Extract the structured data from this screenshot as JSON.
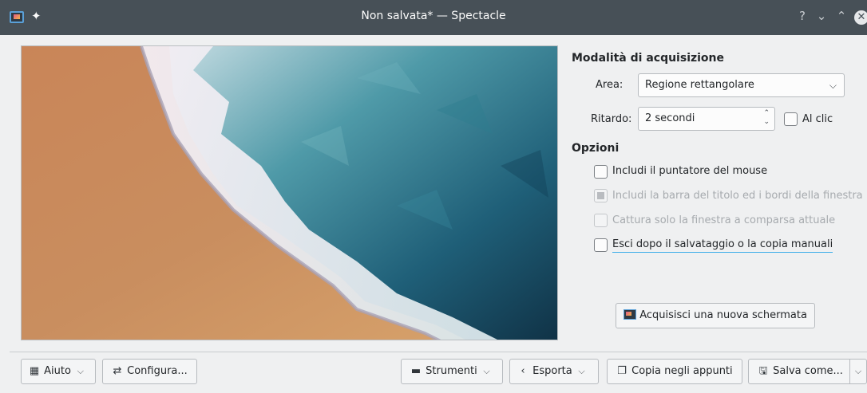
{
  "window": {
    "title": "Non salvata* — Spectacle",
    "help_glyph": "?",
    "minimize_glyph": "⌄",
    "maximize_glyph": "⌃",
    "close_glyph": "✕",
    "pin_glyph": "✦"
  },
  "capture": {
    "heading": "Modalità di acquisizione",
    "area_label": "Area:",
    "area_value": "Regione rettangolare",
    "delay_label": "Ritardo:",
    "delay_value": "2 secondi",
    "on_click_label": "Al clic",
    "on_click_checked": false
  },
  "options": {
    "heading": "Opzioni",
    "items": [
      {
        "label": "Includi il puntatore del mouse",
        "checked": false,
        "enabled": true
      },
      {
        "label": "Includi la barra del titolo ed i bordi della finestra",
        "checked": "partial",
        "enabled": false
      },
      {
        "label": "Cattura solo la finestra a comparsa attuale",
        "checked": false,
        "enabled": false
      },
      {
        "label": "Esci dopo il salvataggio o la copia manuali",
        "checked": false,
        "enabled": true
      }
    ]
  },
  "new_screenshot_button": "Acquisisci una nuova schermata",
  "toolbar": {
    "help": "Aiuto",
    "configure": "Configura...",
    "tools": "Strumenti",
    "export": "Esporta",
    "copy": "Copia negli appunti",
    "save_as": "Salva come..."
  },
  "colors": {
    "titlebar": "#475057",
    "window_bg": "#eff0f1",
    "accent": "#3daee9",
    "sand": "#c98e5f",
    "sea_dark": "#123a52",
    "sea_light": "#4f9aa8"
  },
  "icons": {
    "app": "spectacle-icon",
    "pin": "pin-icon",
    "help": "help-book-icon",
    "configure": "sliders-icon",
    "tools": "toolbox-icon",
    "export": "share-icon",
    "copy": "clipboard-icon",
    "save": "save-icon"
  }
}
